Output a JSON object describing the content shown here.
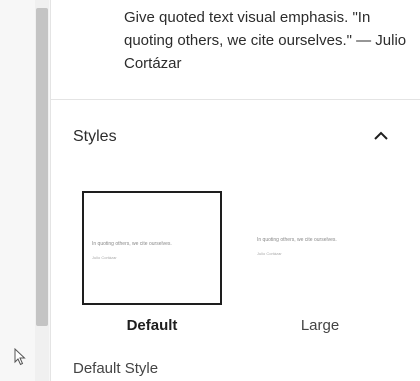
{
  "block": {
    "description": "Give quoted text visual emphasis. \"In quoting others, we cite ourselves.\" — Julio Cortázar"
  },
  "styles_panel": {
    "title": "Styles",
    "options": [
      {
        "label": "Default",
        "preview_quote": "In quoting others, we cite ourselves.",
        "preview_cite": "Julio Cortázar",
        "selected": true
      },
      {
        "label": "Large",
        "preview_quote": "In quoting others, we cite ourselves.",
        "preview_cite": "Julio Cortázar",
        "selected": false
      }
    ],
    "default_style_label": "Default Style"
  },
  "icons": {
    "collapse": "chevron-up-icon",
    "cursor": "mouse-pointer-icon"
  },
  "colors": {
    "selected_border": "#1e1e1e",
    "scrollbar_thumb": "#c4c4c4"
  }
}
